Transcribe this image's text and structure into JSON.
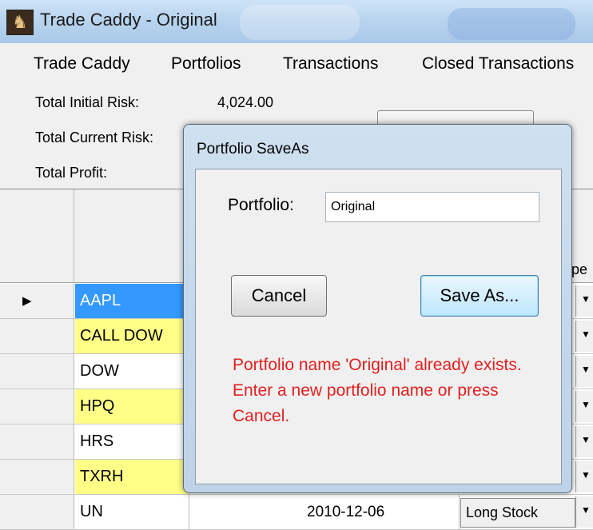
{
  "window": {
    "title": "Trade Caddy - Original",
    "menu": [
      "Trade Caddy",
      "Portfolios",
      "Transactions",
      "Closed Transactions"
    ]
  },
  "summary": {
    "initial_risk_label": "Total Initial  Risk:",
    "initial_risk_value": "4,024.00",
    "current_risk_label": "Total Current Risk:",
    "profit_label": "Total Profit:"
  },
  "grid": {
    "type_header_partial": "ype",
    "rows": [
      {
        "symbol": "AAPL",
        "highlight": "#3399ff",
        "selected": true
      },
      {
        "symbol": "CALL DOW",
        "highlight": "#ffff88"
      },
      {
        "symbol": "DOW",
        "highlight": "#ffffff"
      },
      {
        "symbol": "HPQ",
        "highlight": "#ffff88"
      },
      {
        "symbol": "HRS",
        "highlight": "#ffffff"
      },
      {
        "symbol": "TXRH",
        "highlight": "#ffff88"
      },
      {
        "symbol": "UN",
        "highlight": "#ffffff",
        "date": "2010-12-06",
        "type": "Long Stock"
      }
    ]
  },
  "dialog": {
    "title": "Portfolio SaveAs",
    "portfolio_label": "Portfolio:",
    "portfolio_value": "Original",
    "cancel_label": "Cancel",
    "saveas_label": "Save As...",
    "error_message": "Portfolio name 'Original' already exists. Enter a new portfolio name or press Cancel.",
    "error_color": "#e02020"
  }
}
